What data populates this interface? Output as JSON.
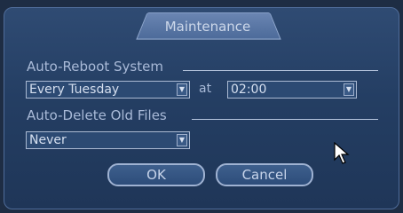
{
  "dialog": {
    "title": "Maintenance",
    "auto_reboot_label": "Auto-Reboot System",
    "reboot_day": "Every Tuesday",
    "at_label": "at",
    "reboot_time": "02:00",
    "auto_delete_label": "Auto-Delete Old Files",
    "delete_option": "Never",
    "ok_label": "OK",
    "cancel_label": "Cancel"
  },
  "icons": {
    "dropdown": "chevron-down-icon",
    "cursor": "mouse-pointer-icon"
  }
}
